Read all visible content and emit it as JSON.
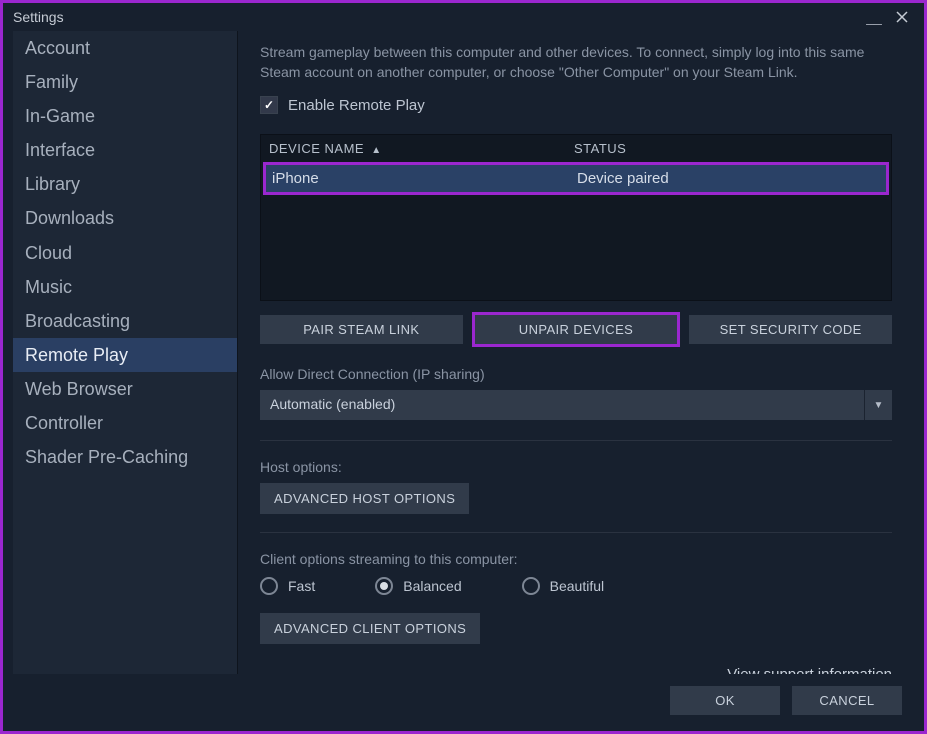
{
  "window": {
    "title": "Settings"
  },
  "sidebar": {
    "items": [
      {
        "label": "Account",
        "selected": false
      },
      {
        "label": "Family",
        "selected": false
      },
      {
        "label": "In-Game",
        "selected": false
      },
      {
        "label": "Interface",
        "selected": false
      },
      {
        "label": "Library",
        "selected": false
      },
      {
        "label": "Downloads",
        "selected": false
      },
      {
        "label": "Cloud",
        "selected": false
      },
      {
        "label": "Music",
        "selected": false
      },
      {
        "label": "Broadcasting",
        "selected": false
      },
      {
        "label": "Remote Play",
        "selected": true
      },
      {
        "label": "Web Browser",
        "selected": false
      },
      {
        "label": "Controller",
        "selected": false
      },
      {
        "label": "Shader Pre-Caching",
        "selected": false
      }
    ]
  },
  "content": {
    "description": "Stream gameplay between this computer and other devices. To connect, simply log into this same Steam account on another computer, or choose \"Other Computer\" on your Steam Link.",
    "enable_label": "Enable Remote Play",
    "table": {
      "col_device": "DEVICE NAME",
      "col_status": "STATUS",
      "rows": [
        {
          "name": "iPhone",
          "status": "Device paired"
        }
      ]
    },
    "buttons": {
      "pair": "PAIR STEAM LINK",
      "unpair": "UNPAIR DEVICES",
      "security": "SET SECURITY CODE"
    },
    "direct": {
      "label": "Allow Direct Connection (IP sharing)",
      "value": "Automatic (enabled)"
    },
    "host": {
      "label": "Host options:",
      "button": "ADVANCED HOST OPTIONS"
    },
    "client": {
      "label": "Client options streaming to this computer:",
      "options": [
        {
          "label": "Fast",
          "selected": false
        },
        {
          "label": "Balanced",
          "selected": true
        },
        {
          "label": "Beautiful",
          "selected": false
        }
      ],
      "button": "ADVANCED CLIENT OPTIONS"
    },
    "support_link": "View support information"
  },
  "footer": {
    "ok": "OK",
    "cancel": "CANCEL"
  }
}
